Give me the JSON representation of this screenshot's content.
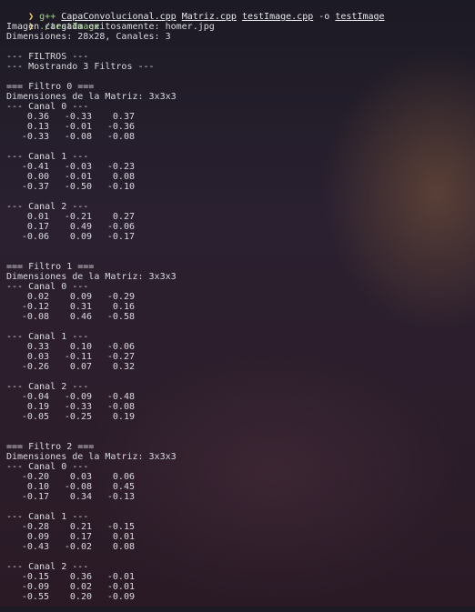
{
  "prompt_symbol": "❯",
  "commands": [
    {
      "program": "g++",
      "files": [
        "CapaConvolucional.cpp",
        "Matriz.cpp",
        "testImage.cpp"
      ],
      "flag": "-o",
      "output": "testImage"
    },
    {
      "program": "./testImage"
    }
  ],
  "output_lines": [
    "Imagen cargada exitosamente: homer.jpg",
    "Dimensiones: 28x28, Canales: 3",
    "",
    "--- FILTROS ---",
    "--- Mostrando 3 Filtros ---",
    ""
  ],
  "filters": [
    {
      "header": "=== Filtro 0 ===",
      "dims": "Dimensiones de la Matriz: 3x3x3",
      "channels": [
        {
          "label": "--- Canal 0 ---",
          "rows": [
            [
              "0.36",
              "-0.33",
              "0.37"
            ],
            [
              "0.13",
              "-0.01",
              "-0.36"
            ],
            [
              "-0.33",
              "-0.08",
              "-0.08"
            ]
          ]
        },
        {
          "label": "--- Canal 1 ---",
          "rows": [
            [
              "-0.41",
              "-0.03",
              "-0.23"
            ],
            [
              "0.00",
              "-0.01",
              "0.08"
            ],
            [
              "-0.37",
              "-0.50",
              "-0.10"
            ]
          ]
        },
        {
          "label": "--- Canal 2 ---",
          "rows": [
            [
              "0.01",
              "-0.21",
              "0.27"
            ],
            [
              "0.17",
              "0.49",
              "-0.06"
            ],
            [
              "-0.06",
              "0.09",
              "-0.17"
            ]
          ]
        }
      ]
    },
    {
      "header": "=== Filtro 1 ===",
      "dims": "Dimensiones de la Matriz: 3x3x3",
      "channels": [
        {
          "label": "--- Canal 0 ---",
          "rows": [
            [
              "0.02",
              "0.09",
              "-0.29"
            ],
            [
              "-0.12",
              "0.31",
              "0.16"
            ],
            [
              "-0.08",
              "0.46",
              "-0.58"
            ]
          ]
        },
        {
          "label": "--- Canal 1 ---",
          "rows": [
            [
              "0.33",
              "0.10",
              "-0.06"
            ],
            [
              "0.03",
              "-0.11",
              "-0.27"
            ],
            [
              "-0.26",
              "0.07",
              "0.32"
            ]
          ]
        },
        {
          "label": "--- Canal 2 ---",
          "rows": [
            [
              "-0.04",
              "-0.09",
              "-0.48"
            ],
            [
              "0.19",
              "-0.33",
              "-0.08"
            ],
            [
              "-0.05",
              "-0.25",
              "0.19"
            ]
          ]
        }
      ]
    },
    {
      "header": "=== Filtro 2 ===",
      "dims": "Dimensiones de la Matriz: 3x3x3",
      "channels": [
        {
          "label": "--- Canal 0 ---",
          "rows": [
            [
              "-0.20",
              "0.03",
              "0.06"
            ],
            [
              "0.10",
              "-0.08",
              "0.45"
            ],
            [
              "-0.17",
              "0.34",
              "-0.13"
            ]
          ]
        },
        {
          "label": "--- Canal 1 ---",
          "rows": [
            [
              "-0.28",
              "0.21",
              "-0.15"
            ],
            [
              "0.09",
              "0.17",
              "0.01"
            ],
            [
              "-0.43",
              "-0.02",
              "0.08"
            ]
          ]
        },
        {
          "label": "--- Canal 2 ---",
          "rows": [
            [
              "-0.15",
              "0.36",
              "-0.01"
            ],
            [
              "-0.09",
              "0.02",
              "-0.01"
            ],
            [
              "-0.55",
              "0.20",
              "-0.09"
            ]
          ]
        }
      ]
    }
  ]
}
